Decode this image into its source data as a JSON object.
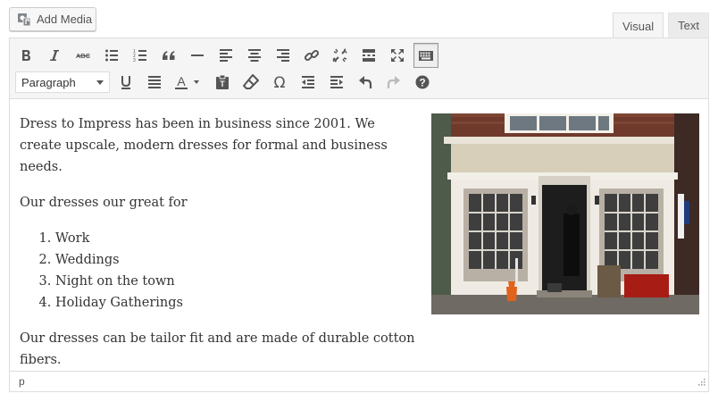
{
  "media_button": {
    "label": "Add Media",
    "icon": "add-media-icon"
  },
  "tabs": [
    {
      "label": "Visual",
      "active": true
    },
    {
      "label": "Text",
      "active": false
    }
  ],
  "toolbar": {
    "format_select": {
      "value": "Paragraph"
    }
  },
  "content": {
    "intro_line1": "Dress to Impress has been in business since 2001. We",
    "intro_line2": "create upscale, modern dresses for formal and business needs.",
    "list_intro": "Our dresses our great for",
    "list": [
      "Work",
      "Weddings",
      "Night on the town",
      "Holiday Gatherings"
    ],
    "closing": "Our dresses can be tailor fit and are made of durable cotton fibers."
  },
  "statusbar": {
    "path": "p"
  },
  "colors": {
    "toolbar_bg": "#f5f5f5",
    "border": "#dddddd",
    "icon": "#555555"
  }
}
